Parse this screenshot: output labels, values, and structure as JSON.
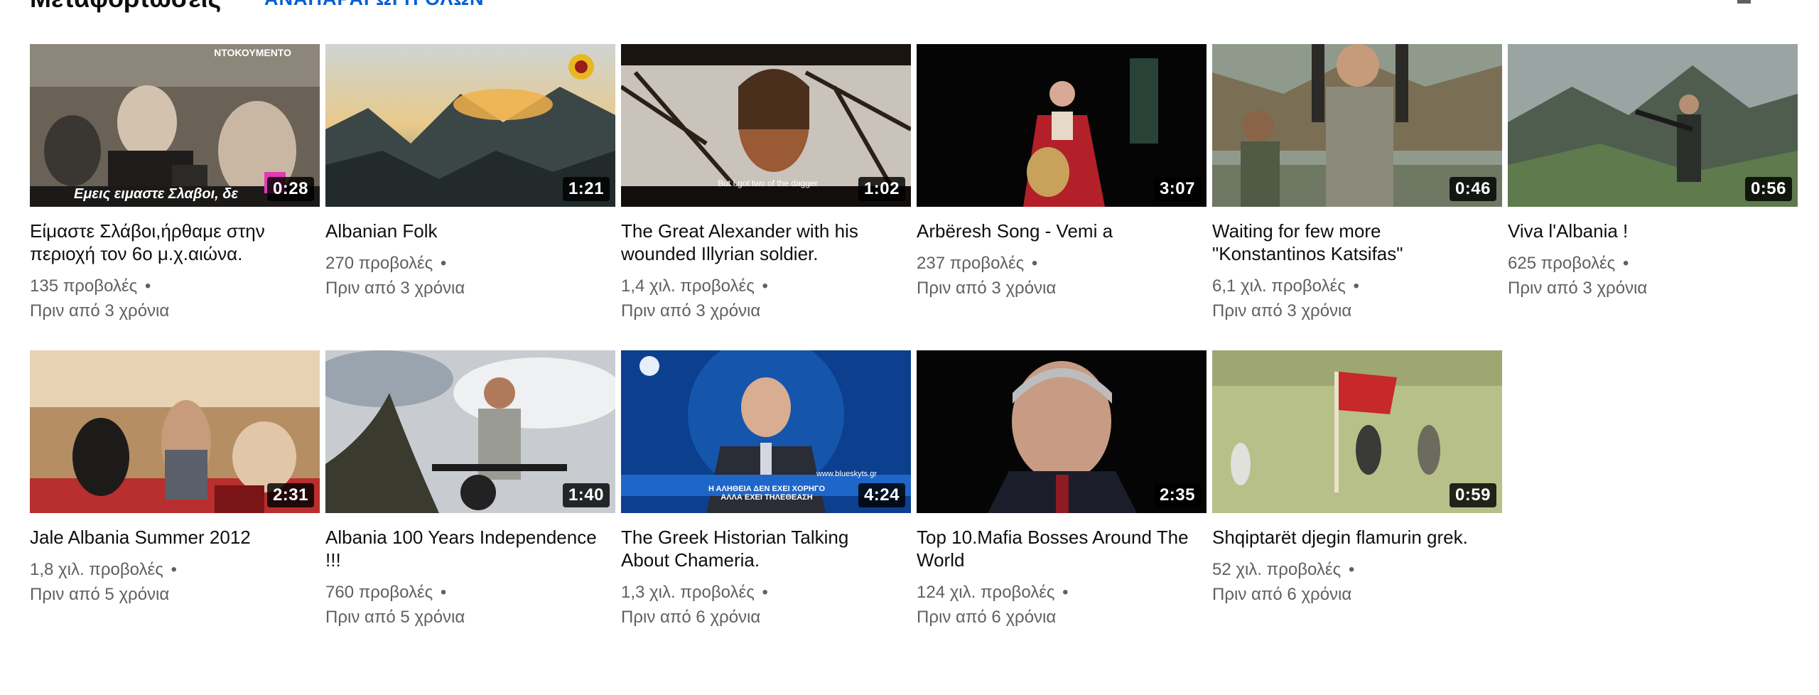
{
  "header": {
    "title": "Μεταφορτώσεις",
    "play_all_label": "ΑΝΑΠΑΡΑΓΩΓΗ ΟΛΩΝ"
  },
  "videos": [
    {
      "title": "Είμαστε Σλάβοι,ήρθαμε στην περιοχή τον 6ο μ.χ.αιώνα.",
      "views": "135 προβολές",
      "age": "Πριν από 3 χρόνια",
      "duration": "0:28",
      "overlay_top": "ΝΤΟΚΟΥΜΕΝΤΟ",
      "overlay_bottom": "Εμεις ειμαστε Σλαβοι, δε"
    },
    {
      "title": "Albanian Folk",
      "views": "270 προβολές",
      "age": "Πριν από 3 χρόνια",
      "duration": "1:21"
    },
    {
      "title": "The Great Alexander with his wounded Illyrian soldier.",
      "views": "1,4 χιλ. προβολές",
      "age": "Πριν από 3 χρόνια",
      "duration": "1:02",
      "overlay_bottom": "But I got two of the dagger"
    },
    {
      "title": "Arbëresh Song - Vemi a",
      "views": "237 προβολές",
      "age": "Πριν από 3 χρόνια",
      "duration": "3:07"
    },
    {
      "title": "Waiting for few more \"Konstantinos Katsifas\"",
      "views": "6,1 χιλ. προβολές",
      "age": "Πριν από 3 χρόνια",
      "duration": "0:46"
    },
    {
      "title": "Viva l'Albania !",
      "views": "625 προβολές",
      "age": "Πριν από 3 χρόνια",
      "duration": "0:56"
    },
    {
      "title": "Jale Albania Summer 2012",
      "views": "1,8 χιλ. προβολές",
      "age": "Πριν από 5 χρόνια",
      "duration": "2:31"
    },
    {
      "title": "Albania 100 Years Independence !!!",
      "views": "760 προβολές",
      "age": "Πριν από 5 χρόνια",
      "duration": "1:40"
    },
    {
      "title": "The Greek Historian Talking About Chameria.",
      "views": "1,3 χιλ. προβολές",
      "age": "Πριν από 6 χρόνια",
      "duration": "4:24",
      "overlay_top": "www.blueskyts.gr",
      "overlay_bottom": "Η ΑΛΗΘΕΙΑ ΔΕΝ ΕΧΕΙ ΧΟΡΗΓΟ ΑΛΛΑ ΕΧΕΙ ΤΗΛΕΘΕΑΣΗ"
    },
    {
      "title": "Top 10.Mafia Bosses Around The World",
      "views": "124 χιλ. προβολές",
      "age": "Πριν από 6 χρόνια",
      "duration": "2:35"
    },
    {
      "title": "Shqiptarët djegin flamurin grek.",
      "views": "52 χιλ. προβολές",
      "age": "Πριν από 6 χρόνια",
      "duration": "0:59"
    }
  ]
}
